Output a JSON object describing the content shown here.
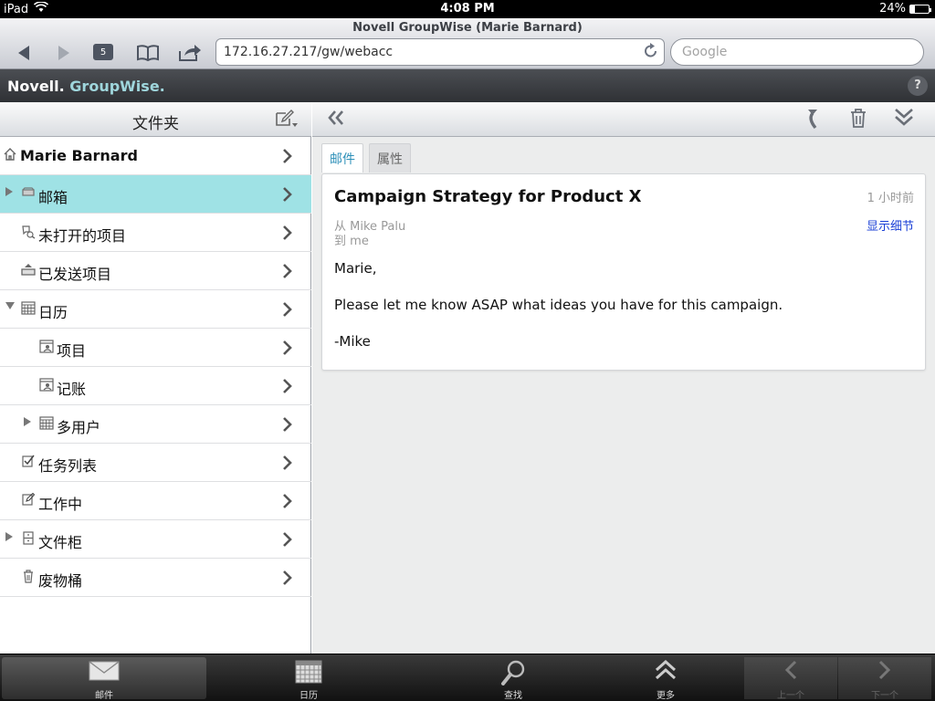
{
  "status_bar": {
    "device": "iPad",
    "time": "4:08 PM",
    "battery": "24%",
    "battery_level": 0.24
  },
  "browser": {
    "page_title": "Novell GroupWise (Marie Barnard)",
    "tab_count": "5",
    "url": "172.16.27.217/gw/webacc",
    "search_placeholder": "Google"
  },
  "app": {
    "brand_novell": "Novell.",
    "brand_groupwise": "GroupWise.",
    "help_label": "?"
  },
  "folders": {
    "title": "文件夹",
    "items": [
      {
        "label": "Marie Barnard",
        "icon": "home-icon",
        "level": 0,
        "bold": true,
        "expander": "",
        "selected": false
      },
      {
        "label": "邮箱",
        "icon": "mailbox-icon",
        "level": 0,
        "bold": false,
        "expander": "collapsed",
        "selected": true
      },
      {
        "label": "未打开的项目",
        "icon": "unopened-icon",
        "level": 0,
        "bold": false,
        "expander": "",
        "selected": false
      },
      {
        "label": "已发送项目",
        "icon": "sent-icon",
        "level": 0,
        "bold": false,
        "expander": "",
        "selected": false
      },
      {
        "label": "日历",
        "icon": "calendar-icon",
        "level": 0,
        "bold": false,
        "expander": "expanded",
        "selected": false
      },
      {
        "label": "项目",
        "icon": "subcalendar-icon",
        "level": 1,
        "bold": false,
        "expander": "",
        "selected": false
      },
      {
        "label": "记账",
        "icon": "subcalendar-icon",
        "level": 1,
        "bold": false,
        "expander": "",
        "selected": false
      },
      {
        "label": "多用户",
        "icon": "calendar-icon",
        "level": 1,
        "bold": false,
        "expander": "collapsed",
        "selected": false
      },
      {
        "label": "任务列表",
        "icon": "tasklist-icon",
        "level": 0,
        "bold": false,
        "expander": "",
        "selected": false
      },
      {
        "label": "工作中",
        "icon": "work-in-progress-icon",
        "level": 0,
        "bold": false,
        "expander": "",
        "selected": false
      },
      {
        "label": "文件柜",
        "icon": "cabinet-icon",
        "level": 0,
        "bold": false,
        "expander": "collapsed",
        "selected": false
      },
      {
        "label": "废物桶",
        "icon": "trash-icon",
        "level": 0,
        "bold": false,
        "expander": "",
        "selected": false
      }
    ]
  },
  "message": {
    "tabs": [
      {
        "label": "邮件",
        "active": true
      },
      {
        "label": "属性",
        "active": false
      }
    ],
    "subject": "Campaign Strategy for Product X",
    "time_ago": "1 小时前",
    "from_label": "从",
    "from_name": "Mike Palu",
    "to_label": "到",
    "to_name": "me",
    "details_link": "显示细节",
    "body": [
      "Marie,",
      "Please let me know ASAP what ideas you have for this campaign.",
      "-Mike"
    ]
  },
  "tab_bar": {
    "items": [
      {
        "label": "邮件",
        "icon": "mail-icon",
        "active": true
      },
      {
        "label": "日历",
        "icon": "calendar-icon",
        "active": false
      },
      {
        "label": "查找",
        "icon": "search-icon",
        "active": false
      },
      {
        "label": "更多",
        "icon": "more-icon",
        "active": false
      },
      {
        "label": "上一个",
        "icon": "previous-icon",
        "active": false
      },
      {
        "label": "下一个",
        "icon": "next-icon",
        "active": false
      }
    ]
  }
}
